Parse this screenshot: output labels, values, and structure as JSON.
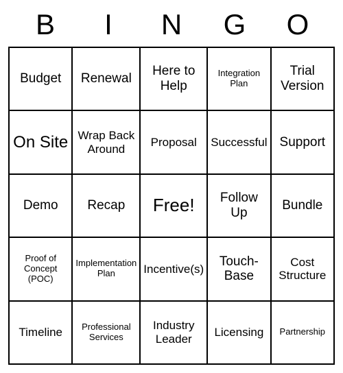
{
  "header": [
    "B",
    "I",
    "N",
    "G",
    "O"
  ],
  "cells": [
    {
      "label": "Budget",
      "size": ""
    },
    {
      "label": "Renewal",
      "size": ""
    },
    {
      "label": "Here to Help",
      "size": ""
    },
    {
      "label": "Integration Plan",
      "size": "small"
    },
    {
      "label": "Trial Version",
      "size": ""
    },
    {
      "label": "On Site",
      "size": "large"
    },
    {
      "label": "Wrap Back Around",
      "size": "medium"
    },
    {
      "label": "Proposal",
      "size": "medium"
    },
    {
      "label": "Successful",
      "size": "medium"
    },
    {
      "label": "Support",
      "size": ""
    },
    {
      "label": "Demo",
      "size": ""
    },
    {
      "label": "Recap",
      "size": ""
    },
    {
      "label": "Free!",
      "size": "free"
    },
    {
      "label": "Follow Up",
      "size": ""
    },
    {
      "label": "Bundle",
      "size": ""
    },
    {
      "label": "Proof of Concept (POC)",
      "size": "small"
    },
    {
      "label": "Implementation Plan",
      "size": "small"
    },
    {
      "label": "Incentive(s)",
      "size": "medium"
    },
    {
      "label": "Touch-Base",
      "size": ""
    },
    {
      "label": "Cost Structure",
      "size": "medium"
    },
    {
      "label": "Timeline",
      "size": "medium"
    },
    {
      "label": "Professional Services",
      "size": "small"
    },
    {
      "label": "Industry Leader",
      "size": "medium"
    },
    {
      "label": "Licensing",
      "size": "medium"
    },
    {
      "label": "Partnership",
      "size": "small"
    }
  ]
}
